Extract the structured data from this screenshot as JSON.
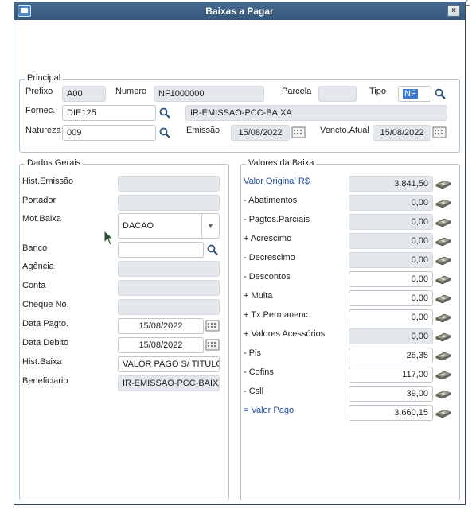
{
  "window": {
    "title": "Baixas a Pagar",
    "close_label": "×"
  },
  "principal": {
    "title": "Principal",
    "prefixo_label": "Prefixo",
    "prefixo_value": "A00",
    "numero_label": "Numero",
    "numero_value": "NF1000000",
    "parcela_label": "Parcela",
    "parcela_value": "",
    "tipo_label": "Tipo",
    "tipo_value": "NF",
    "fornec_label": "Fornec.",
    "fornec_value": "DIE125",
    "fornec_nome": "IR-EMISSAO-PCC-BAIXA",
    "natureza_label": "Natureza",
    "natureza_value": "009",
    "emissao_label": "Emissão",
    "emissao_value": "15/08/2022",
    "vencto_label": "Vencto.Atual",
    "vencto_value": "15/08/2022"
  },
  "dados": {
    "title": "Dados Gerais",
    "hist_emissao_label": "Hist.Emissão",
    "hist_emissao_value": "",
    "portador_label": "Portador",
    "portador_value": "",
    "mot_baixa_label": "Mot.Baixa",
    "mot_baixa_value": "DACAO",
    "banco_label": "Banco",
    "banco_value": "",
    "agencia_label": "Agência",
    "agencia_value": "",
    "conta_label": "Conta",
    "conta_value": "",
    "cheque_label": "Cheque No.",
    "cheque_value": "",
    "data_pagto_label": "Data Pagto.",
    "data_pagto_value": "15/08/2022",
    "data_debito_label": "Data Debito",
    "data_debito_value": "15/08/2022",
    "hist_baixa_label": "Hist.Baixa",
    "hist_baixa_value": "VALOR PAGO S/ TITULO",
    "beneficiario_label": "Beneficiario",
    "beneficiario_value": "IR-EMISSAO-PCC-BAIXA"
  },
  "valores": {
    "title": "Valores da Baixa",
    "rows": [
      {
        "label": "Valor Original R$",
        "value": "3.841,50"
      },
      {
        "label": "- Abatimentos",
        "value": "0,00"
      },
      {
        "label": "- Pagtos.Parciais",
        "value": "0,00"
      },
      {
        "label": "+ Acrescimo",
        "value": "0,00"
      },
      {
        "label": "- Decrescimo",
        "value": "0,00"
      },
      {
        "label": "- Descontos",
        "value": "0,00"
      },
      {
        "label": "+ Multa",
        "value": "0,00"
      },
      {
        "label": "+ Tx.Permanenc.",
        "value": "0,00"
      },
      {
        "label": "+ Valores Acessórios",
        "value": "0,00"
      },
      {
        "label": "- Pis",
        "value": "25,35"
      },
      {
        "label": "- Cofins",
        "value": "117,00"
      },
      {
        "label": "- Csll",
        "value": "39,00"
      },
      {
        "label": "= Valor Pago",
        "value": "3.660,15"
      }
    ]
  },
  "decor": {
    "corner_mark": "∠"
  }
}
